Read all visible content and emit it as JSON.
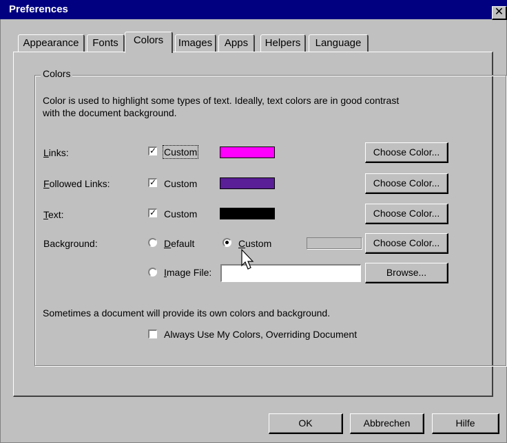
{
  "window": {
    "title": "Preferences",
    "close_glyph": "✕"
  },
  "tabs": [
    {
      "label": "Appearance",
      "active": false
    },
    {
      "label": "Fonts",
      "active": false
    },
    {
      "label": "Colors",
      "active": true
    },
    {
      "label": "Images",
      "active": false
    },
    {
      "label": "Apps",
      "active": false
    },
    {
      "label": "Helpers",
      "active": false
    },
    {
      "label": "Language",
      "active": false
    }
  ],
  "colors_group": {
    "title": "Colors",
    "description_line1": "Color is used to highlight some types of text.  Ideally, text colors are in good contrast",
    "description_line2": "with the document background.",
    "rows": {
      "links": {
        "label": "Links:",
        "custom_label": "Custom",
        "checked": true,
        "swatch_color": "#ff00ff",
        "button": "Choose Color..."
      },
      "followed_links": {
        "label": "Followed Links:",
        "custom_label": "Custom",
        "checked": true,
        "swatch_color": "#5a1e96",
        "button": "Choose Color..."
      },
      "text": {
        "label": "Text:",
        "custom_label": "Custom",
        "checked": true,
        "swatch_color": "#000000",
        "button": "Choose Color..."
      },
      "background": {
        "label": "Background:",
        "default_label": "Default",
        "custom_label": "Custom",
        "selected": "custom",
        "button": "Choose Color..."
      },
      "image_file": {
        "label": "Image File:",
        "value": "",
        "button": "Browse..."
      }
    },
    "override_note": "Sometimes a document will provide its own colors and background.",
    "always_use_label": "Always Use My Colors, Overriding Document",
    "always_use_checked": false
  },
  "footer": {
    "ok": "OK",
    "cancel": "Abbrechen",
    "help": "Hilfe"
  },
  "icons": {
    "cursor": "arrow-cursor-icon",
    "check": "✓"
  }
}
